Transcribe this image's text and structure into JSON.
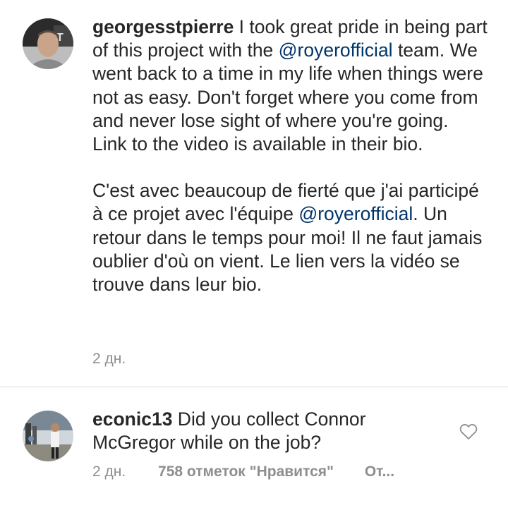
{
  "post": {
    "username": "georgesstpierre",
    "text_part1": " I took great pride in being part of this project with the ",
    "mention1": "@royerofficial",
    "text_part2": " team. We went back to a time in my life when things were not as easy. Don't forget where you come from and never lose sight of where you're going. Link to the video is available in their bio.",
    "fr_part1": "C'est avec beaucoup de fierté que j'ai participé à ce projet avec l'équipe ",
    "mention2": "@royerofficial",
    "fr_part2": ". Un retour dans le temps pour moi! Il ne faut jamais oublier d'où on vient. Le lien vers la vidéo se trouve dans leur bio.",
    "time": "2 дн.",
    "avatar_icon": "avatar-georgesstpierre"
  },
  "comment": {
    "username": "econic13",
    "text": " Did you collect Connor McGregor while on the job?",
    "time": "2 дн.",
    "likes": "758 отметок \"Нравится\"",
    "reply": "От...",
    "like_icon": "heart-outline-icon",
    "avatar_icon": "avatar-econic13"
  }
}
